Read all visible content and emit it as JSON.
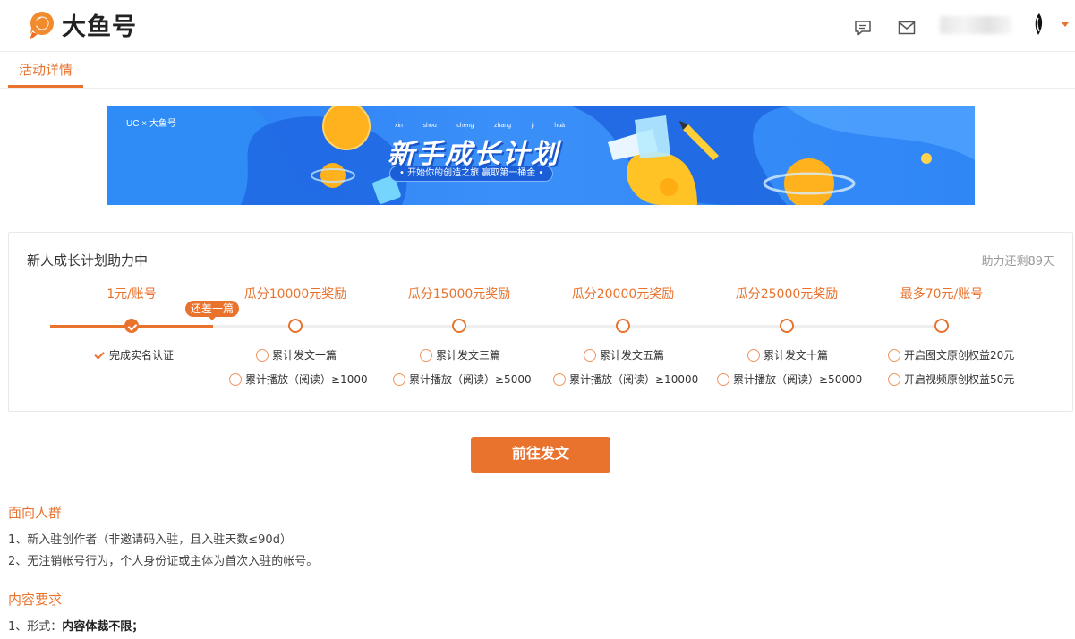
{
  "header": {
    "logo_text": "大鱼号",
    "icons": [
      "message-icon",
      "mail-icon",
      "chevron-down-icon"
    ],
    "accent": "#e9722d"
  },
  "tabs": [
    {
      "label": "活动详情",
      "active": true
    }
  ],
  "banner": {
    "brand": "UC × 大鱼号",
    "pinyin": [
      "xin",
      "shou",
      "cheng",
      "zhang",
      "ji",
      "huà"
    ],
    "title": "新手成长计划",
    "subtitle": "• 开始你的创造之旅 赢取第一桶金 •"
  },
  "progress": {
    "title": "新人成长计划助力中",
    "remaining": "助力还剩89天",
    "tip": "还差一篇",
    "current_stage": 1,
    "stages": [
      {
        "label": "1元/账号",
        "reqs": [
          {
            "text": "完成实名认证",
            "done": true
          }
        ]
      },
      {
        "label": "瓜分10000元奖励",
        "reqs": [
          {
            "text": "累计发文一篇",
            "done": false
          },
          {
            "text": "累计播放（阅读）≥1000",
            "done": false
          }
        ]
      },
      {
        "label": "瓜分15000元奖励",
        "reqs": [
          {
            "text": "累计发文三篇",
            "done": false
          },
          {
            "text": "累计播放（阅读）≥5000",
            "done": false
          }
        ]
      },
      {
        "label": "瓜分20000元奖励",
        "reqs": [
          {
            "text": "累计发文五篇",
            "done": false
          },
          {
            "text": "累计播放（阅读）≥10000",
            "done": false
          }
        ]
      },
      {
        "label": "瓜分25000元奖励",
        "reqs": [
          {
            "text": "累计发文十篇",
            "done": false
          },
          {
            "text": "累计播放（阅读）≥50000",
            "done": false
          }
        ]
      },
      {
        "label": "最多70元/账号",
        "reqs": [
          {
            "text": "开启图文原创权益20元",
            "done": false
          },
          {
            "text": "开启视频原创权益50元",
            "done": false
          }
        ]
      }
    ]
  },
  "cta": {
    "label": "前往发文"
  },
  "sections": {
    "audience": {
      "title": "面向人群",
      "lines": [
        "1、新入驻创作者（非邀请码入驻，且入驻天数≤90d）",
        "2、无注销帐号行为，个人身份证或主体为首次入驻的帐号。"
      ]
    },
    "content": {
      "title": "内容要求",
      "line1_prefix": "1、形式：",
      "line1_bold": "内容体裁不限；"
    }
  }
}
